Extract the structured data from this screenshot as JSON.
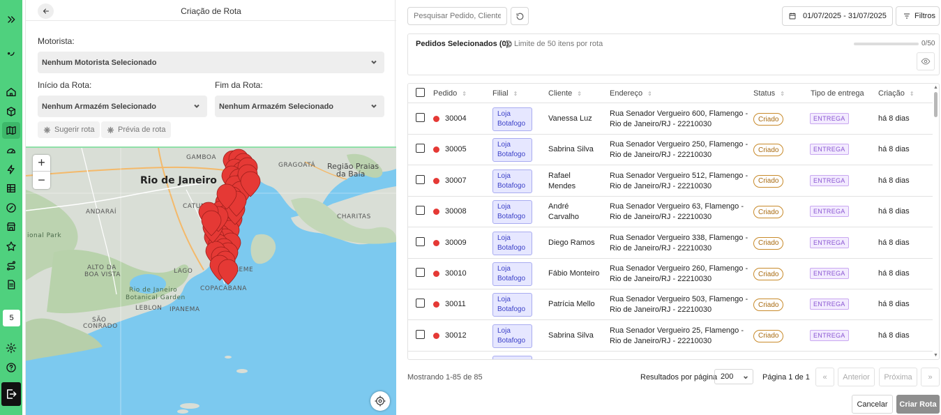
{
  "sidebar": {
    "badge": "5",
    "icons": [
      "chevrons-right-icon",
      "logo-icon",
      "home-icon",
      "package-icon",
      "map-icon",
      "gauge-icon",
      "bolt-icon",
      "table-icon",
      "percent-icon",
      "store-icon",
      "star-icon",
      "route-icon",
      "document-icon",
      "gear-icon",
      "help-icon",
      "logout-icon"
    ]
  },
  "route_panel": {
    "title": "Criação de Rota",
    "driver_label": "Motorista:",
    "driver_value": "Nenhum Motorista Selecionado",
    "start_label": "Início da Rota:",
    "start_value": "Nenhum Armazém Selecionado",
    "end_label": "Fim da Rota:",
    "end_value": "Nenhum Armazém Selecionado",
    "suggest_button": "Sugerir rota",
    "preview_button": "Prévia de rota"
  },
  "map": {
    "labels": {
      "gamboa": "GAMBOA",
      "rio": "Rio de Janeiro",
      "catumbi": "CATUMBI",
      "andarai": "ANDARAÍ",
      "gragoata": "GRAGOATÁ",
      "regiao": "Região Praias",
      "baia": "da Baía",
      "charitas": "CHARITAS",
      "park": "ional Park",
      "alto": "ALTO DA",
      "boavista": "BOA VISTA",
      "garden1": "Rio de Janeiro",
      "garden2": "Botanical Garden",
      "leblon": "LEBLON",
      "ipanema": "IPANEMA",
      "sao": "SÃO",
      "conrado": "CONRADO",
      "copacabana": "COPACABANA",
      "leme": "LEME",
      "lagoa": "LAGO"
    },
    "zoom_in": "+",
    "zoom_out": "−",
    "marker_color": "#e53935"
  },
  "toolbar": {
    "search_placeholder": "Pesquisar Pedido, Cliente, Loja...",
    "date_range": "01/07/2025 - 31/07/2025",
    "filters_label": "Filtros"
  },
  "selection": {
    "title": "Pedidos Selecionados (0):",
    "hint": "Limite de 50 itens por rota",
    "progress_text": "0/50",
    "progress_fraction": 0
  },
  "table": {
    "columns": [
      "Pedido",
      "Filial",
      "Cliente",
      "Endereço",
      "Status",
      "Tipo de entrega",
      "Criação"
    ],
    "rows": [
      {
        "id": "30004",
        "branch1": "Loja",
        "branch2": "Botafogo",
        "client1": "Vanessa Luz",
        "client2": "",
        "addr1": "Rua Senador Vergueiro 600, Flamengo -",
        "addr2": "Rio de Janeiro/RJ - 22210030",
        "status": "Criado",
        "type": "ENTREGA",
        "created": "há 8 dias"
      },
      {
        "id": "30005",
        "branch1": "Loja",
        "branch2": "Botafogo",
        "client1": "Sabrina Silva",
        "client2": "",
        "addr1": "Rua Senador Vergueiro 250, Flamengo -",
        "addr2": "Rio de Janeiro/RJ - 22210030",
        "status": "Criado",
        "type": "ENTREGA",
        "created": "há 8 dias"
      },
      {
        "id": "30007",
        "branch1": "Loja",
        "branch2": "Botafogo",
        "client1": "Rafael",
        "client2": "Mendes",
        "addr1": "Rua Senador Vergueiro 512, Flamengo -",
        "addr2": "Rio de Janeiro/RJ - 22210030",
        "status": "Criado",
        "type": "ENTREGA",
        "created": "há 8 dias"
      },
      {
        "id": "30008",
        "branch1": "Loja",
        "branch2": "Botafogo",
        "client1": "André",
        "client2": "Carvalho",
        "addr1": "Rua Senador Vergueiro 63, Flamengo -",
        "addr2": "Rio de Janeiro/RJ - 22210030",
        "status": "Criado",
        "type": "ENTREGA",
        "created": "há 8 dias"
      },
      {
        "id": "30009",
        "branch1": "Loja",
        "branch2": "Botafogo",
        "client1": "Diego Ramos",
        "client2": "",
        "addr1": "Rua Senador Vergueiro 338, Flamengo -",
        "addr2": "Rio de Janeiro/RJ - 22210030",
        "status": "Criado",
        "type": "ENTREGA",
        "created": "há 8 dias"
      },
      {
        "id": "30010",
        "branch1": "Loja",
        "branch2": "Botafogo",
        "client1": "Fábio Monteiro",
        "client2": "",
        "addr1": "Rua Senador Vergueiro 260, Flamengo -",
        "addr2": "Rio de Janeiro/RJ - 22210030",
        "status": "Criado",
        "type": "ENTREGA",
        "created": "há 8 dias"
      },
      {
        "id": "30011",
        "branch1": "Loja",
        "branch2": "Botafogo",
        "client1": "Patrícia Mello",
        "client2": "",
        "addr1": "Rua Senador Vergueiro 503, Flamengo -",
        "addr2": "Rio de Janeiro/RJ - 22210030",
        "status": "Criado",
        "type": "ENTREGA",
        "created": "há 8 dias"
      },
      {
        "id": "30012",
        "branch1": "Loja",
        "branch2": "Botafogo",
        "client1": "Sabrina Silva",
        "client2": "",
        "addr1": "Rua Senador Vergueiro 25, Flamengo -",
        "addr2": "Rio de Janeiro/RJ - 22210030",
        "status": "Criado",
        "type": "ENTREGA",
        "created": "há 8 dias"
      }
    ]
  },
  "footer": {
    "showing": "Mostrando 1-85 de 85",
    "per_page_label": "Resultados por página",
    "per_page_value": "200",
    "page_info": "Página 1 de 1",
    "first": "«",
    "prev": "Anterior",
    "next": "Próxima",
    "last": "»",
    "cancel": "Cancelar",
    "create": "Criar Rota"
  }
}
